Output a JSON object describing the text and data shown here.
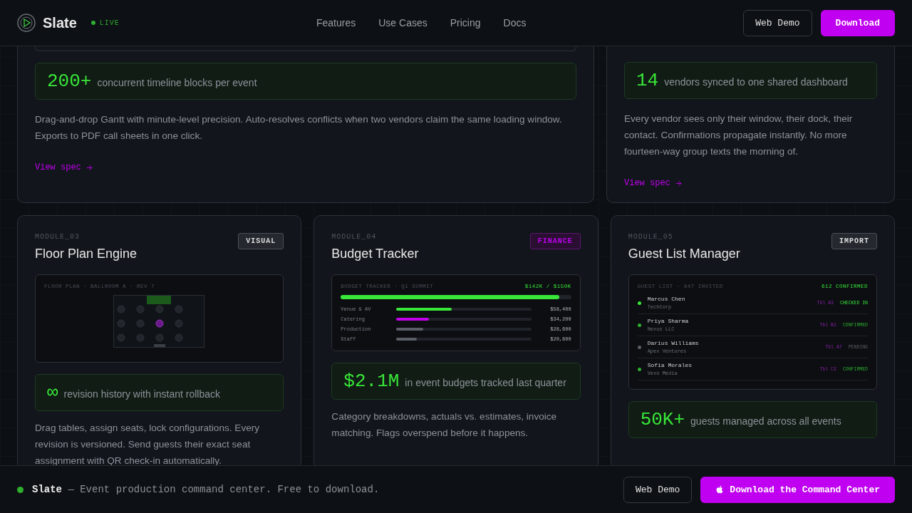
{
  "nav": {
    "brand": "Slate",
    "status": "LIVE",
    "links": [
      "Features",
      "Use Cases",
      "Pricing",
      "Docs"
    ],
    "secondary_button": "Web Demo",
    "primary_button": "Download"
  },
  "top_cards": [
    {
      "stat_value": "200+",
      "stat_label": "concurrent timeline blocks per event",
      "description": "Drag-and-drop Gantt with minute-level precision. Auto-resolves conflicts when two vendors claim the same loading window. Exports to PDF call sheets in one click.",
      "link": "View spec"
    },
    {
      "stat_value": "14",
      "stat_label": "vendors synced to one shared dashboard",
      "description": "Every vendor sees only their window, their dock, their contact. Confirmations propagate instantly. No more fourteen-way group texts the morning of.",
      "link": "View spec"
    }
  ],
  "modules": [
    {
      "kind": "floorplan",
      "label": "MODULE_03",
      "title": "Floor Plan Engine",
      "tag": "VISUAL",
      "tag_accent": false,
      "panel": {
        "header": "FLOOR PLAN · BALLROOM A · REV 7"
      },
      "stat_value": "∞",
      "stat_label": "revision history with instant rollback",
      "description": "Drag tables, assign seats, lock configurations. Every revision is versioned. Send guests their exact seat assignment with QR check-in automatically."
    },
    {
      "kind": "budget",
      "label": "MODULE_04",
      "title": "Budget Tracker",
      "tag": "FINANCE",
      "tag_accent": true,
      "panel": {
        "header": "BUDGET TRACKER · Q1 SUMMIT",
        "total": "$142K / $150K",
        "level": 0.95,
        "rows": [
          {
            "name": "Venue & AV",
            "amount": "$58,400",
            "level": 0.41,
            "color": "#39e639"
          },
          {
            "name": "Catering",
            "amount": "$34,200",
            "level": 0.24,
            "color": "#c000e8"
          },
          {
            "name": "Production",
            "amount": "$28,600",
            "level": 0.2,
            "color": "#5a5e66"
          },
          {
            "name": "Staff",
            "amount": "$20,800",
            "level": 0.15,
            "color": "#5a5e66"
          }
        ]
      },
      "stat_value": "$2.1M",
      "stat_label": "in event budgets tracked last quarter",
      "description": "Category breakdowns, actuals vs. estimates, invoice matching. Flags overspend before it happens."
    },
    {
      "kind": "guests",
      "label": "MODULE_05",
      "title": "Guest List Manager",
      "tag": "IMPORT",
      "tag_accent": false,
      "panel": {
        "header": "GUEST LIST · 847 INVITED",
        "total": "612 CONFIRMED",
        "rows": [
          {
            "name": "Marcus Chen",
            "org": "TechCorp",
            "table": "Tbl A3",
            "status": "CHECKED IN",
            "color": "#39e639"
          },
          {
            "name": "Priya Sharma",
            "org": "Nexus LLC",
            "table": "Tbl B1",
            "status": "CONFIRMED",
            "color": "#2fae2f"
          },
          {
            "name": "Darius Williams",
            "org": "Apex Ventures",
            "table": "Tbl A7",
            "status": "PENDING",
            "color": "#5a5e66"
          },
          {
            "name": "Sofia Morales",
            "org": "Vexo Media",
            "table": "Tbl C2",
            "status": "CONFIRMED",
            "color": "#2fae2f"
          }
        ]
      },
      "stat_value": "50K+",
      "stat_label": "guests managed across all events"
    }
  ],
  "footer": {
    "text": "**Slate** — Event production command center. Free to download.",
    "secondary_button": "Web Demo",
    "primary_button": "Download the Command Center"
  }
}
